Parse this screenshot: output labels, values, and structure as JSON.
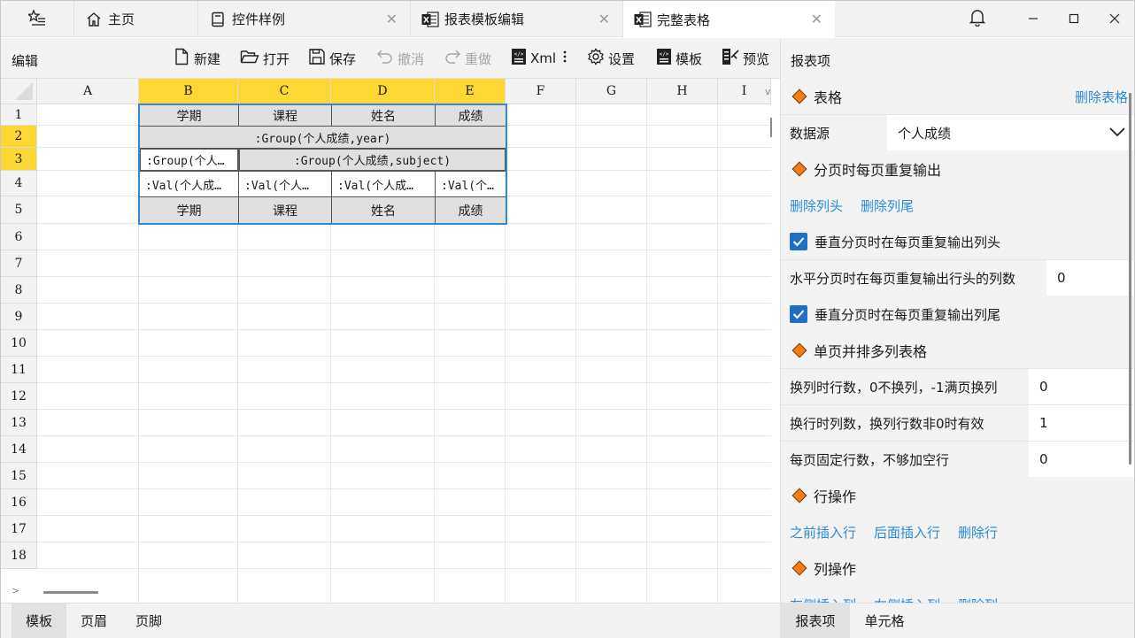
{
  "titlebar": {
    "tabs": [
      {
        "label": "主页",
        "icon": "home-icon",
        "closable": false
      },
      {
        "label": "控件样例",
        "icon": "book-icon",
        "closable": true
      },
      {
        "label": "报表模板编辑",
        "icon": "excel-icon",
        "closable": true
      },
      {
        "label": "完整表格",
        "icon": "excel-icon",
        "closable": true
      }
    ],
    "close_glyph": "✕",
    "active_tab": 3
  },
  "toolbar": {
    "title": "编辑",
    "new": "新建",
    "open": "打开",
    "save": "保存",
    "undo": "撤消",
    "redo": "重做",
    "xml": "Xml",
    "settings": "设置",
    "template": "模板",
    "preview": "预览"
  },
  "grid": {
    "columns": [
      "A",
      "B",
      "C",
      "D",
      "E",
      "F",
      "G",
      "H",
      "I"
    ],
    "selected_columns": [
      "B",
      "C",
      "D",
      "E"
    ],
    "rows": [
      "1",
      "2",
      "3",
      "4",
      "5",
      "6",
      "7",
      "8",
      "9",
      "10",
      "11",
      "12",
      "13",
      "14",
      "15",
      "16",
      "17",
      "18"
    ],
    "selected_rows": [
      "2",
      "3"
    ],
    "cells": {
      "r1": [
        "学期",
        "课程",
        "姓名",
        "成绩"
      ],
      "r2": ":Group(个人成绩,year)",
      "r3_b": ":Group(个人…",
      "r3_cde": ":Group(个人成绩,subject)",
      "r4": [
        ":Val(个人成…",
        ":Val(个人…",
        ":Val(个人成…",
        ":Val(个…"
      ],
      "r5": [
        "学期",
        "课程",
        "姓名",
        "成绩"
      ]
    },
    "scroll_marker": "v",
    "hscroll_marker": ">"
  },
  "bottom_tabs": [
    "模板",
    "页眉",
    "页脚"
  ],
  "panel": {
    "title": "报表项",
    "table_section": "表格",
    "delete_table": "删除表格",
    "datasource_label": "数据源",
    "datasource_value": "个人成绩",
    "paging_section": "分页时每页重复输出",
    "delete_header": "删除列头",
    "delete_footer": "删除列尾",
    "repeat_header_label": "垂直分页时在每页重复输出列头",
    "repeat_header_checked": true,
    "repeat_row_cols_label": "水平分页时在每页重复输出行头的列数",
    "repeat_row_cols_value": "0",
    "repeat_footer_label": "垂直分页时在每页重复输出列尾",
    "repeat_footer_checked": true,
    "multi_section": "单页并排多列表格",
    "wrap_rows_label": "换列时行数，0不换列，-1满页换列",
    "wrap_rows_value": "0",
    "wrap_cols_label": "换行时列数，换列行数非0时有效",
    "wrap_cols_value": "1",
    "fixed_rows_label": "每页固定行数，不够加空行",
    "fixed_rows_value": "0",
    "row_section": "行操作",
    "insert_before": "之前插入行",
    "insert_after": "后面插入行",
    "delete_row": "删除行",
    "col_section": "列操作",
    "insert_left": "左侧插入列",
    "insert_right": "右侧插入列",
    "delete_col": "删除列"
  },
  "panel_tabs": [
    "报表项",
    "单元格"
  ],
  "colors": {
    "accent": "#2b8ad8",
    "selection": "#fdd835",
    "diamond": "#f07d1a",
    "checkbox": "#1f6fc2"
  }
}
